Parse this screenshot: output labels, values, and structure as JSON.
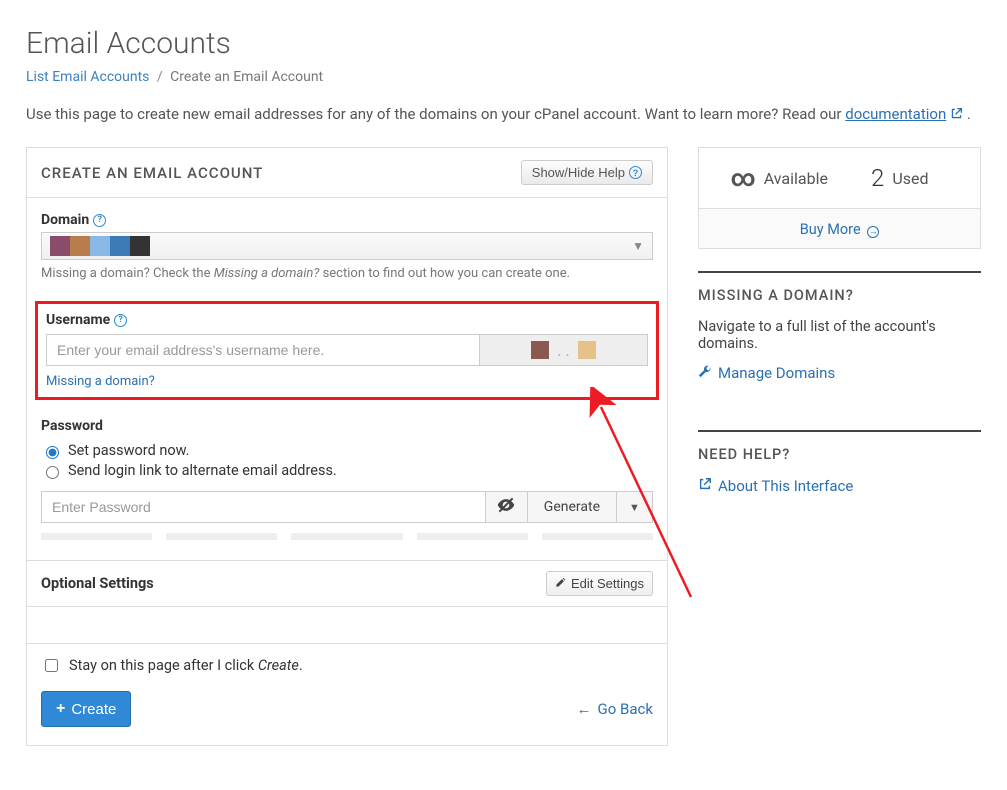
{
  "page_title": "Email Accounts",
  "breadcrumb": {
    "list_link": "List Email Accounts",
    "current": "Create an Email Account"
  },
  "intro": {
    "text_before": "Use this page to create new email addresses for any of the domains on your cPanel account. Want to learn more? Read our ",
    "doc_link": "documentation",
    "text_after": " ."
  },
  "panel": {
    "heading": "CREATE AN EMAIL ACCOUNT",
    "help_button": "Show/Hide Help",
    "domain": {
      "label": "Domain",
      "hint_before": "Missing a domain? Check the ",
      "hint_italic": "Missing a domain?",
      "hint_after": " section to find out how you can create one."
    },
    "username": {
      "label": "Username",
      "placeholder": "Enter your email address's username here.",
      "missing_link": "Missing a domain?"
    },
    "password": {
      "label": "Password",
      "radio_now": "Set password now.",
      "radio_send": "Send login link to alternate email address.",
      "placeholder": "Enter Password",
      "generate": "Generate"
    },
    "optional": {
      "title": "Optional Settings",
      "edit": "Edit Settings"
    },
    "footer": {
      "stay_before": "Stay on this page after I click ",
      "stay_italic": "Create",
      "stay_after": ".",
      "create": "Create",
      "goback": "Go Back"
    }
  },
  "sidebar": {
    "stats": {
      "available_label": "Available",
      "used_value": "2",
      "used_label": "Used",
      "buy": "Buy More"
    },
    "missing": {
      "heading": "MISSING A DOMAIN?",
      "text": "Navigate to a full list of the account's domains.",
      "link": "Manage Domains"
    },
    "help": {
      "heading": "NEED HELP?",
      "link": "About This Interface"
    }
  }
}
